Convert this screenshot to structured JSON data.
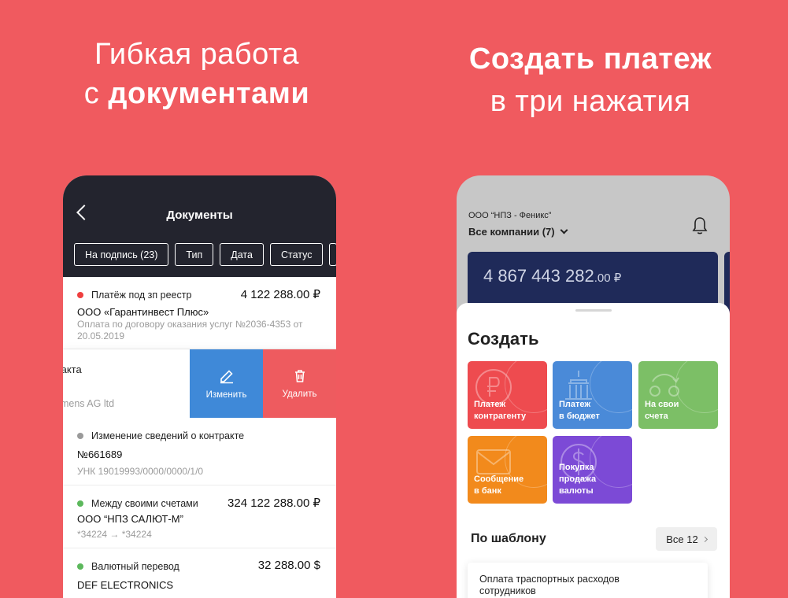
{
  "colors": {
    "background": "#f05a5f",
    "header_dark": "#23242e",
    "edit": "#3f89d8",
    "delete": "#ee5b5f",
    "card": "#1f2a59"
  },
  "left_headline": {
    "line1": "Гибкая работа",
    "line2_prefix": "с ",
    "line2_bold": "документами"
  },
  "right_headline": {
    "line1": "Создать платеж",
    "line2": "в три нажатия"
  },
  "documents_screen": {
    "title": "Документы",
    "filters": [
      "На подпись (23)",
      "Тип",
      "Дата",
      "Статус"
    ],
    "items": [
      {
        "status_color": "#ef3f3f",
        "type": "Платёж под зп реестр",
        "amount": "4 122 288.00 ₽",
        "name": "ООО «Гарантинвест Плюс»",
        "sub": "Оплата по договору оказания услуг №2036-4353 от 20.05.2019"
      },
      {
        "status_color": "#9a9a9a",
        "type": "Изменение сведений о контракте",
        "amount": "",
        "name": "№661689",
        "sub": "УНК 19019993/0000/0000/1/0"
      },
      {
        "status_color": "#5cb85c",
        "type": "Между своими счетами",
        "amount": "324 122 288.00 ₽",
        "name": "ООО “НПЗ САЛЮТ-М”",
        "sub": "*34224  →  *34224"
      },
      {
        "status_color": "#5cb85c",
        "type": "Валютный перевод",
        "amount": "32 288.00 $",
        "name": "DEF ELECTRONICS",
        "sub": ""
      }
    ],
    "swiped": {
      "text1": "онтракта",
      "text2": "emens AG ltd",
      "edit_label": "Изменить",
      "delete_label": "Удалить"
    }
  },
  "create_screen": {
    "company": "ООО “НПЗ - Феникс”",
    "all_companies": "Все компании (7)",
    "balance_main": "4 867 443 282",
    "balance_cents": ".00 ₽",
    "sheet_title": "Создать",
    "tiles": [
      {
        "label": "Платеж\nконтрагенту",
        "icon": "ruble-icon",
        "color": "#ee4b4f"
      },
      {
        "label": "Платеж\nв бюджет",
        "icon": "government-building-icon",
        "color": "#4a8ad8"
      },
      {
        "label": "На свои\nсчета",
        "icon": "transfer-circles-icon",
        "color": "#7cbf66"
      },
      {
        "label": "Сообщение\nв банк",
        "icon": "envelope-icon",
        "color": "#f28a1c"
      },
      {
        "label": "Покупка\nпродажа\nвалюты",
        "icon": "dollar-icon",
        "color": "#7c4ad6"
      }
    ],
    "templates_title": "По шаблону",
    "all_label": "Все 12",
    "template_card": "Оплата траспортных расходов сотрудников"
  }
}
